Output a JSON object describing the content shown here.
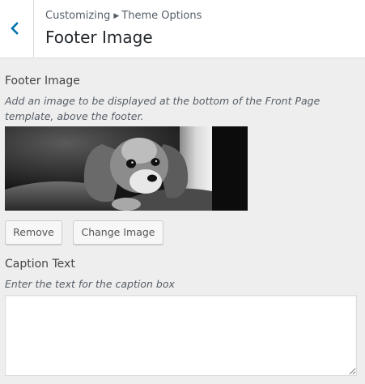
{
  "header": {
    "breadcrumb_parent": "Customizing",
    "breadcrumb_current": "Theme Options",
    "title": "Footer Image",
    "back_icon": "chevron-left-icon",
    "accent_color": "#0073aa"
  },
  "footer_image": {
    "label": "Footer Image",
    "description": "Add an image to be displayed at the bottom of the Front Page template, above the footer.",
    "image_subject": "black and white photo of a puppy",
    "remove_label": "Remove",
    "change_label": "Change Image"
  },
  "caption": {
    "label": "Caption Text",
    "description": "Enter the text for the caption box",
    "value": ""
  }
}
